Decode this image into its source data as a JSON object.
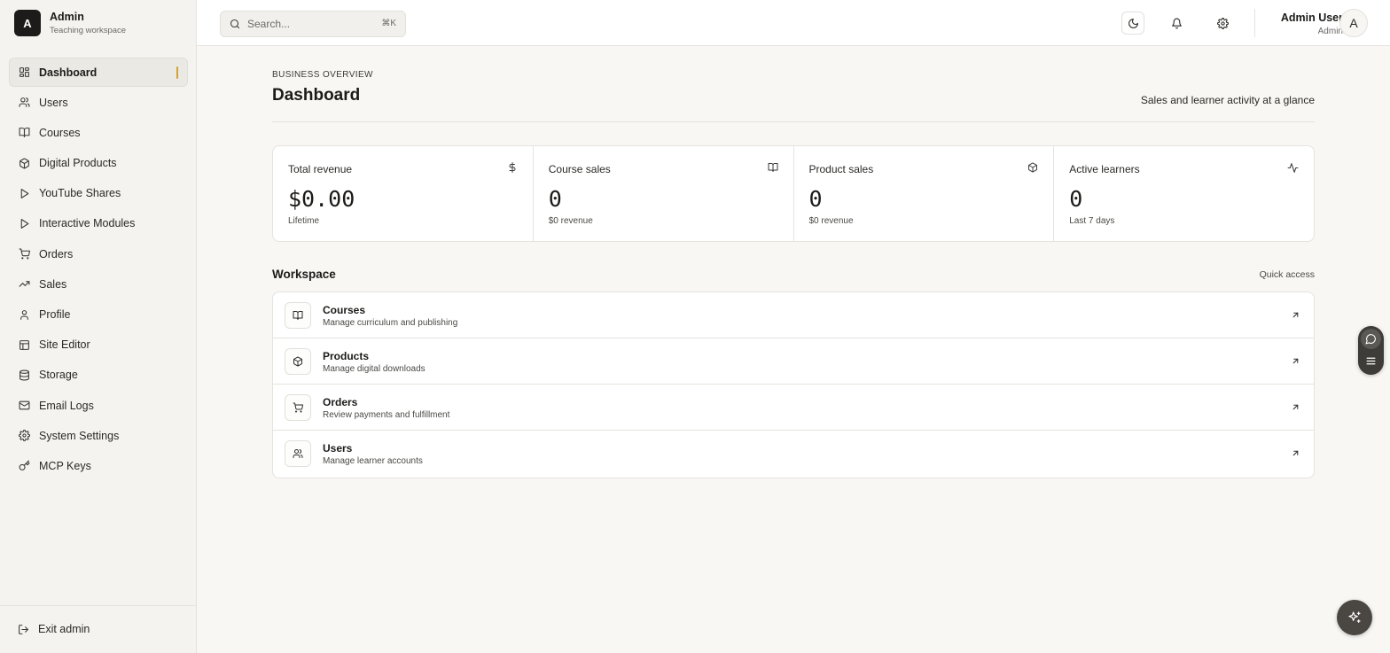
{
  "brand": {
    "logo_letter": "A",
    "name": "Admin",
    "subtitle": "Teaching workspace"
  },
  "sidebar": {
    "items": [
      {
        "label": "Dashboard",
        "icon": "dashboard-icon",
        "active": true
      },
      {
        "label": "Users",
        "icon": "users-icon"
      },
      {
        "label": "Courses",
        "icon": "book-open-icon"
      },
      {
        "label": "Digital Products",
        "icon": "package-icon"
      },
      {
        "label": "YouTube Shares",
        "icon": "play-icon"
      },
      {
        "label": "Interactive Modules",
        "icon": "play-icon"
      },
      {
        "label": "Orders",
        "icon": "cart-icon"
      },
      {
        "label": "Sales",
        "icon": "trending-up-icon"
      },
      {
        "label": "Profile",
        "icon": "user-icon"
      },
      {
        "label": "Site Editor",
        "icon": "layout-icon"
      },
      {
        "label": "Storage",
        "icon": "database-icon"
      },
      {
        "label": "Email Logs",
        "icon": "mail-icon"
      },
      {
        "label": "System Settings",
        "icon": "gear-icon"
      },
      {
        "label": "MCP Keys",
        "icon": "key-icon"
      }
    ],
    "exit_label": "Exit admin"
  },
  "topbar": {
    "search_placeholder": "Search...",
    "search_shortcut": "⌘K",
    "user_name": "Admin User",
    "user_role": "Admin",
    "avatar_letter": "A"
  },
  "page": {
    "eyebrow": "BUSINESS OVERVIEW",
    "title": "Dashboard",
    "subtitle": "Sales and learner activity at a glance"
  },
  "stats": [
    {
      "label": "Total revenue",
      "value": "$0.00",
      "note": "Lifetime",
      "icon": "dollar-icon"
    },
    {
      "label": "Course sales",
      "value": "0",
      "note": "$0 revenue",
      "icon": "book-open-icon"
    },
    {
      "label": "Product sales",
      "value": "0",
      "note": "$0 revenue",
      "icon": "package-icon"
    },
    {
      "label": "Active learners",
      "value": "0",
      "note": "Last 7 days",
      "icon": "activity-icon"
    }
  ],
  "workspace": {
    "title": "Workspace",
    "quick_access": "Quick access",
    "items": [
      {
        "name": "Courses",
        "desc": "Manage curriculum and publishing",
        "icon": "book-open-icon"
      },
      {
        "name": "Products",
        "desc": "Manage digital downloads",
        "icon": "package-icon"
      },
      {
        "name": "Orders",
        "desc": "Review payments and fulfillment",
        "icon": "cart-icon"
      },
      {
        "name": "Users",
        "desc": "Manage learner accounts",
        "icon": "users-icon"
      }
    ]
  },
  "colors": {
    "accent": "#d4a137",
    "brand": "#1c1b19",
    "background": "#f8f7f4"
  }
}
